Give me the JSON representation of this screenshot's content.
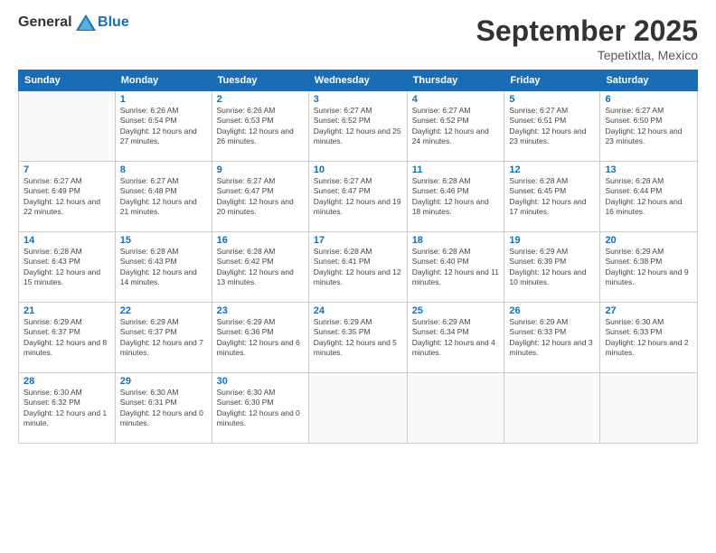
{
  "header": {
    "logo_general": "General",
    "logo_blue": "Blue",
    "month_title": "September 2025",
    "location": "Tepetixtla, Mexico"
  },
  "weekdays": [
    "Sunday",
    "Monday",
    "Tuesday",
    "Wednesday",
    "Thursday",
    "Friday",
    "Saturday"
  ],
  "weeks": [
    [
      {
        "day": "",
        "sunrise": "",
        "sunset": "",
        "daylight": ""
      },
      {
        "day": "1",
        "sunrise": "Sunrise: 6:26 AM",
        "sunset": "Sunset: 6:54 PM",
        "daylight": "Daylight: 12 hours and 27 minutes."
      },
      {
        "day": "2",
        "sunrise": "Sunrise: 6:26 AM",
        "sunset": "Sunset: 6:53 PM",
        "daylight": "Daylight: 12 hours and 26 minutes."
      },
      {
        "day": "3",
        "sunrise": "Sunrise: 6:27 AM",
        "sunset": "Sunset: 6:52 PM",
        "daylight": "Daylight: 12 hours and 25 minutes."
      },
      {
        "day": "4",
        "sunrise": "Sunrise: 6:27 AM",
        "sunset": "Sunset: 6:52 PM",
        "daylight": "Daylight: 12 hours and 24 minutes."
      },
      {
        "day": "5",
        "sunrise": "Sunrise: 6:27 AM",
        "sunset": "Sunset: 6:51 PM",
        "daylight": "Daylight: 12 hours and 23 minutes."
      },
      {
        "day": "6",
        "sunrise": "Sunrise: 6:27 AM",
        "sunset": "Sunset: 6:50 PM",
        "daylight": "Daylight: 12 hours and 23 minutes."
      }
    ],
    [
      {
        "day": "7",
        "sunrise": "Sunrise: 6:27 AM",
        "sunset": "Sunset: 6:49 PM",
        "daylight": "Daylight: 12 hours and 22 minutes."
      },
      {
        "day": "8",
        "sunrise": "Sunrise: 6:27 AM",
        "sunset": "Sunset: 6:48 PM",
        "daylight": "Daylight: 12 hours and 21 minutes."
      },
      {
        "day": "9",
        "sunrise": "Sunrise: 6:27 AM",
        "sunset": "Sunset: 6:47 PM",
        "daylight": "Daylight: 12 hours and 20 minutes."
      },
      {
        "day": "10",
        "sunrise": "Sunrise: 6:27 AM",
        "sunset": "Sunset: 6:47 PM",
        "daylight": "Daylight: 12 hours and 19 minutes."
      },
      {
        "day": "11",
        "sunrise": "Sunrise: 6:28 AM",
        "sunset": "Sunset: 6:46 PM",
        "daylight": "Daylight: 12 hours and 18 minutes."
      },
      {
        "day": "12",
        "sunrise": "Sunrise: 6:28 AM",
        "sunset": "Sunset: 6:45 PM",
        "daylight": "Daylight: 12 hours and 17 minutes."
      },
      {
        "day": "13",
        "sunrise": "Sunrise: 6:28 AM",
        "sunset": "Sunset: 6:44 PM",
        "daylight": "Daylight: 12 hours and 16 minutes."
      }
    ],
    [
      {
        "day": "14",
        "sunrise": "Sunrise: 6:28 AM",
        "sunset": "Sunset: 6:43 PM",
        "daylight": "Daylight: 12 hours and 15 minutes."
      },
      {
        "day": "15",
        "sunrise": "Sunrise: 6:28 AM",
        "sunset": "Sunset: 6:43 PM",
        "daylight": "Daylight: 12 hours and 14 minutes."
      },
      {
        "day": "16",
        "sunrise": "Sunrise: 6:28 AM",
        "sunset": "Sunset: 6:42 PM",
        "daylight": "Daylight: 12 hours and 13 minutes."
      },
      {
        "day": "17",
        "sunrise": "Sunrise: 6:28 AM",
        "sunset": "Sunset: 6:41 PM",
        "daylight": "Daylight: 12 hours and 12 minutes."
      },
      {
        "day": "18",
        "sunrise": "Sunrise: 6:28 AM",
        "sunset": "Sunset: 6:40 PM",
        "daylight": "Daylight: 12 hours and 11 minutes."
      },
      {
        "day": "19",
        "sunrise": "Sunrise: 6:29 AM",
        "sunset": "Sunset: 6:39 PM",
        "daylight": "Daylight: 12 hours and 10 minutes."
      },
      {
        "day": "20",
        "sunrise": "Sunrise: 6:29 AM",
        "sunset": "Sunset: 6:38 PM",
        "daylight": "Daylight: 12 hours and 9 minutes."
      }
    ],
    [
      {
        "day": "21",
        "sunrise": "Sunrise: 6:29 AM",
        "sunset": "Sunset: 6:37 PM",
        "daylight": "Daylight: 12 hours and 8 minutes."
      },
      {
        "day": "22",
        "sunrise": "Sunrise: 6:29 AM",
        "sunset": "Sunset: 6:37 PM",
        "daylight": "Daylight: 12 hours and 7 minutes."
      },
      {
        "day": "23",
        "sunrise": "Sunrise: 6:29 AM",
        "sunset": "Sunset: 6:36 PM",
        "daylight": "Daylight: 12 hours and 6 minutes."
      },
      {
        "day": "24",
        "sunrise": "Sunrise: 6:29 AM",
        "sunset": "Sunset: 6:35 PM",
        "daylight": "Daylight: 12 hours and 5 minutes."
      },
      {
        "day": "25",
        "sunrise": "Sunrise: 6:29 AM",
        "sunset": "Sunset: 6:34 PM",
        "daylight": "Daylight: 12 hours and 4 minutes."
      },
      {
        "day": "26",
        "sunrise": "Sunrise: 6:29 AM",
        "sunset": "Sunset: 6:33 PM",
        "daylight": "Daylight: 12 hours and 3 minutes."
      },
      {
        "day": "27",
        "sunrise": "Sunrise: 6:30 AM",
        "sunset": "Sunset: 6:33 PM",
        "daylight": "Daylight: 12 hours and 2 minutes."
      }
    ],
    [
      {
        "day": "28",
        "sunrise": "Sunrise: 6:30 AM",
        "sunset": "Sunset: 6:32 PM",
        "daylight": "Daylight: 12 hours and 1 minute."
      },
      {
        "day": "29",
        "sunrise": "Sunrise: 6:30 AM",
        "sunset": "Sunset: 6:31 PM",
        "daylight": "Daylight: 12 hours and 0 minutes."
      },
      {
        "day": "30",
        "sunrise": "Sunrise: 6:30 AM",
        "sunset": "Sunset: 6:30 PM",
        "daylight": "Daylight: 12 hours and 0 minutes."
      },
      {
        "day": "",
        "sunrise": "",
        "sunset": "",
        "daylight": ""
      },
      {
        "day": "",
        "sunrise": "",
        "sunset": "",
        "daylight": ""
      },
      {
        "day": "",
        "sunrise": "",
        "sunset": "",
        "daylight": ""
      },
      {
        "day": "",
        "sunrise": "",
        "sunset": "",
        "daylight": ""
      }
    ]
  ]
}
